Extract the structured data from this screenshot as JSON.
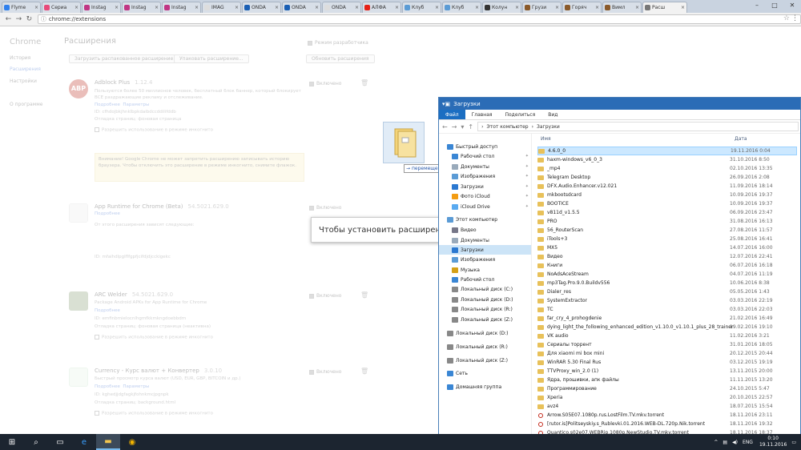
{
  "tabs": [
    {
      "label": "Flyme",
      "color": "#2f80ed"
    },
    {
      "label": "Сериа",
      "color": "#e84a7a"
    },
    {
      "label": "Instag",
      "color": "#c13584"
    },
    {
      "label": "Instag",
      "color": "#c13584"
    },
    {
      "label": "Instag",
      "color": "#c13584"
    },
    {
      "label": "IMAG",
      "color": "#dddddd"
    },
    {
      "label": "ONDA",
      "color": "#1a5fb4"
    },
    {
      "label": "ONDA",
      "color": "#1a5fb4"
    },
    {
      "label": "ONDA",
      "color": "#dddddd"
    },
    {
      "label": "АЛФА",
      "color": "#e62117"
    },
    {
      "label": "Клуб",
      "color": "#5a9bd5"
    },
    {
      "label": "Клуб",
      "color": "#5a9bd5"
    },
    {
      "label": "Колун",
      "color": "#333333"
    },
    {
      "label": "Грузи",
      "color": "#8a5a2b"
    },
    {
      "label": "Горяч",
      "color": "#8a5a2b"
    },
    {
      "label": "Вимл",
      "color": "#8a5a2b"
    },
    {
      "label": "Расш",
      "color": "#777777",
      "active": true
    }
  ],
  "address": {
    "url": "chrome://extensions"
  },
  "ext_page": {
    "side_title": "Chrome",
    "side_items": [
      "История",
      "Расширения",
      "Настройки",
      "О программе"
    ],
    "title": "Расширения",
    "dev_mode": "Режим разработчика",
    "btn_load": "Загрузить распакованное расширение...",
    "btn_pack": "Упаковать расширение...",
    "btn_update": "Обновить расширения",
    "enabled_label": "Включено",
    "details": "Подробнее",
    "params": "Параметры",
    "incognito": "Разрешить использование в режиме инкогнито",
    "extensions": [
      {
        "name": "Adblock Plus",
        "version": "1.12.4",
        "desc": "Пользуются более 50 миллионов человек, бесплатный блок баннер, который блокирует ВСЕ раздражающие рекламу и отслеживание.",
        "id": "ID: cfhdojbkjhnklbpkdaibdccddilifddb",
        "debug": "Отладка страниц: фоновая страница",
        "icon": "ABP",
        "color": "#c0392b"
      },
      {
        "name": "App Runtime for Chrome (Beta)",
        "version": "54.5021.629.0",
        "desc": "От этого расширения зависят следующие:",
        "id": "ID: mfaihdlpglflfgpfjcifdjdjcckigekc",
        "debug": "",
        "icon": "",
        "color": "#dddddd"
      },
      {
        "name": "ARC Welder",
        "version": "54.5021.629.0",
        "desc": "Package Android APKs for App Runtime for Chrome",
        "id": "ID: emfinbmielocnlhgmfkkmkngdoebbdm",
        "debug": "Отладка страниц: фоновая страница (неактивна)",
        "icon": "",
        "color": "#8aa17a"
      },
      {
        "name": "Currency - Курс валют + Конвертер",
        "version": "3.0.10",
        "desc": "Быстрый просмотр курса валют (USD, EUR, GBP, BITCOIN и др.)",
        "id": "ID: kghedjjdgfagkjfohnkmcjpgnpk",
        "debug": "Отладка страниц: background.html",
        "icon": "",
        "color": "#4caf50"
      }
    ],
    "warning": "Внимание! Google Chrome не может запретить расширению записывать историю браузера. Чтобы отключить это расширение в режиме инкогнито, снимите флажок.",
    "install_tip": "Чтобы установить расширение, пер"
  },
  "drag": {
    "move_label": "перемещение",
    "arrow": "→"
  },
  "explorer": {
    "title": "Загрузки",
    "ribbon": [
      "Файл",
      "Главная",
      "Поделиться",
      "Вид"
    ],
    "path": [
      "Этот компьютер",
      "Загрузки"
    ],
    "col_name": "Имя",
    "col_date": "Дата",
    "nav": [
      {
        "label": "Быстрый доступ",
        "color": "#3a86d4",
        "pin": false
      },
      {
        "label": "Рабочий стол",
        "color": "#3a86d4",
        "pin": true
      },
      {
        "label": "Документы",
        "color": "#9ab",
        "pin": true
      },
      {
        "label": "Изображения",
        "color": "#5b9bd5",
        "pin": true
      },
      {
        "label": "Загрузки",
        "color": "#2b78d0",
        "pin": true
      },
      {
        "label": "Фото iCloud",
        "color": "#f39c12",
        "pin": true
      },
      {
        "label": "iCloud Drive",
        "color": "#5aaaf0",
        "pin": true
      },
      {
        "label": "Этот компьютер",
        "color": "#5b9bd5",
        "pin": false
      },
      {
        "label": "Видео",
        "color": "#778",
        "pin": false
      },
      {
        "label": "Документы",
        "color": "#9ab",
        "pin": false
      },
      {
        "label": "Загрузки",
        "color": "#2b78d0",
        "pin": false,
        "sel": true
      },
      {
        "label": "Изображения",
        "color": "#5b9bd5",
        "pin": false
      },
      {
        "label": "Музыка",
        "color": "#d4a017",
        "pin": false
      },
      {
        "label": "Рабочий стол",
        "color": "#3a86d4",
        "pin": false
      },
      {
        "label": "Локальный диск (C:)",
        "color": "#888",
        "pin": false
      },
      {
        "label": "Локальный диск (D:)",
        "color": "#888",
        "pin": false
      },
      {
        "label": "Локальный диск (R:)",
        "color": "#888",
        "pin": false
      },
      {
        "label": "Локальный диск (Z:)",
        "color": "#888",
        "pin": false
      },
      {
        "label": "Локальный диск (D:)",
        "color": "#888",
        "pin": false
      },
      {
        "label": "Локальный диск (R:)",
        "color": "#888",
        "pin": false
      },
      {
        "label": "Локальный диск (Z:)",
        "color": "#888",
        "pin": false
      },
      {
        "label": "Сеть",
        "color": "#3a86d4",
        "pin": false
      },
      {
        "label": "Домашняя группа",
        "color": "#3a86d4",
        "pin": false
      }
    ],
    "files": [
      {
        "name": "4.6.0_0",
        "date": "19.11.2016 0:04",
        "sel": true
      },
      {
        "name": "haxm-windows_v6_0_3",
        "date": "31.10.2016 8:50"
      },
      {
        "name": "_mp4",
        "date": "02.10.2016 13:35"
      },
      {
        "name": "Telegram Desktop",
        "date": "26.09.2016 2:08"
      },
      {
        "name": "DFX.Audio.Enhancer.v12.021",
        "date": "11.09.2016 18:14"
      },
      {
        "name": "mkbootsdcard",
        "date": "10.09.2016 19:37"
      },
      {
        "name": "BOOTICE",
        "date": "10.09.2016 19:37"
      },
      {
        "name": "v811d_v1.5.5",
        "date": "06.09.2016 23:47"
      },
      {
        "name": "PRO",
        "date": "31.08.2016 16:13"
      },
      {
        "name": "56_RouterScan",
        "date": "27.08.2016 11:57"
      },
      {
        "name": "iTools+3",
        "date": "25.08.2016 16:41"
      },
      {
        "name": "MX5",
        "date": "14.07.2016 16:00"
      },
      {
        "name": "Видео",
        "date": "12.07.2016 22:41"
      },
      {
        "name": "Книги",
        "date": "06.07.2016 16:18"
      },
      {
        "name": "NoAdsAceStream",
        "date": "04.07.2016 11:19"
      },
      {
        "name": "mp3Tag.Pro.9.0.Buildv556",
        "date": "10.06.2016 8:38"
      },
      {
        "name": "Dialer_res",
        "date": "05.05.2016 1:43"
      },
      {
        "name": "SystemExtractor",
        "date": "03.03.2016 22:19"
      },
      {
        "name": "TC",
        "date": "03.03.2016 22:03"
      },
      {
        "name": "far_cry_4_prohogdenie",
        "date": "21.02.2016 16:49"
      },
      {
        "name": "dying_light_the_following_enhanced_edition_v1.10.0_v1.10.1_plus_28_trainer",
        "date": "19.02.2016 19:10"
      },
      {
        "name": "VK audio",
        "date": "11.02.2016 3:21"
      },
      {
        "name": "Сериалы торрент",
        "date": "31.01.2016 18:05"
      },
      {
        "name": "Для xiaomi mi box mini",
        "date": "20.12.2015 20:44"
      },
      {
        "name": "WinRAR 5.30 Final Rus",
        "date": "03.12.2015 19:19"
      },
      {
        "name": "TTVProxy_win_2.0 (1)",
        "date": "13.11.2015 20:00"
      },
      {
        "name": "Ядра, прошивки, апк файлы",
        "date": "11.11.2015 13:20"
      },
      {
        "name": "Программирование",
        "date": "24.10.2015 5:47"
      },
      {
        "name": "Xperia",
        "date": "20.10.2015 22:57"
      },
      {
        "name": "avz4",
        "date": "18.07.2015 15:54"
      },
      {
        "name": "Arrow.S05E07.1080p.rus.LostFilm.TV.mkv.torrent",
        "date": "18.11.2016 23:11",
        "tor": true
      },
      {
        "name": "[rutor.is]Politseyskiy.s_Rublevki.01.2016.WEB-DL.720p.Nik.torrent",
        "date": "18.11.2016 19:32",
        "tor": true
      },
      {
        "name": "Quantico.s02e07.WEBRip.1080p.NewStudio.TV.mkv.torrent",
        "date": "18.11.2016 18:37",
        "tor": true
      }
    ]
  },
  "taskbar": {
    "items": [
      {
        "icon": "⊞",
        "name": "start"
      },
      {
        "icon": "⌕",
        "name": "search"
      },
      {
        "icon": "▭",
        "name": "task-view"
      },
      {
        "icon": "e",
        "name": "edge"
      },
      {
        "icon": "▬",
        "name": "explorer"
      },
      {
        "icon": "◉",
        "name": "chrome"
      }
    ],
    "lang": "ENG",
    "time": "0:10",
    "date": "19.11.2016"
  }
}
